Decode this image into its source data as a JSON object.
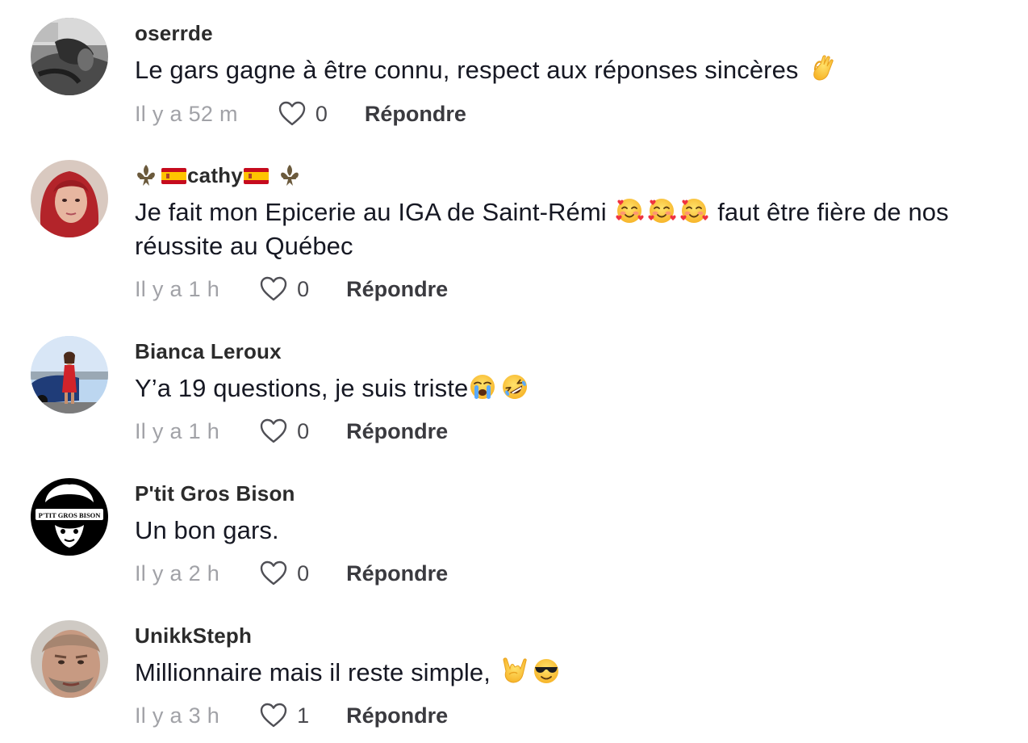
{
  "reply_label": "Répondre",
  "comments": [
    {
      "username": "oserrde",
      "text": "Le gars gagne à être connu, respect aux réponses sincères ",
      "emojis": [
        "ok-hand-emoji"
      ],
      "time": "Il y a 52 m",
      "likes": "0"
    },
    {
      "username": "cathy",
      "username_decorations": [
        "fleur-de-lis-icon",
        "spain-flag-icon",
        "spain-flag-icon",
        "fleur-de-lis-icon"
      ],
      "text_before": "Je fait mon Epicerie au IGA de Saint-Rémi ",
      "emojis": [
        "smiling-face-with-hearts-emoji",
        "smiling-face-with-hearts-emoji",
        "smiling-face-with-hearts-emoji"
      ],
      "text_after": " faut être fière de nos réussite au Québec",
      "time": "Il y a 1 h",
      "likes": "0"
    },
    {
      "username": "Bianca Leroux",
      "text": "Y’a 19 questions, je suis triste",
      "emojis": [
        "loudly-crying-face-emoji",
        "rolling-on-floor-laughing-emoji"
      ],
      "time": "Il y a 1 h",
      "likes": "0"
    },
    {
      "username": "P'tit Gros Bison",
      "text": "Un bon gars.",
      "time": "Il y a 2 h",
      "likes": "0"
    },
    {
      "username": "UnikkSteph",
      "text": "Millionnaire mais il reste simple, ",
      "emojis": [
        "love-you-gesture-emoji",
        "sunglasses-face-emoji"
      ],
      "time": "Il y a 3 h",
      "likes": "1"
    }
  ],
  "avatar_logo_text": "P'TIT GROS BISON",
  "colors": {
    "text": "#161823",
    "username": "#2b2b2b",
    "timestamp": "#a1a2a7",
    "like_count": "#4a4a4f",
    "reply": "#3a3a3f"
  }
}
